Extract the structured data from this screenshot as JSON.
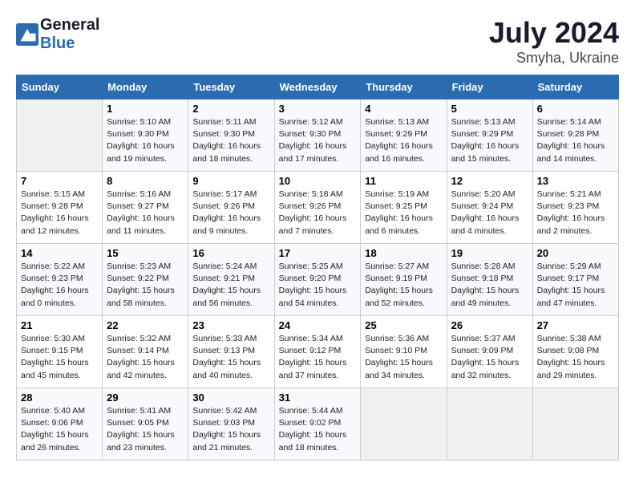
{
  "header": {
    "logo_text_general": "General",
    "logo_text_blue": "Blue",
    "month_year": "July 2024",
    "location": "Smyha, Ukraine"
  },
  "columns": [
    "Sunday",
    "Monday",
    "Tuesday",
    "Wednesday",
    "Thursday",
    "Friday",
    "Saturday"
  ],
  "rows": [
    [
      {
        "day": "",
        "empty": true
      },
      {
        "day": "1",
        "sunrise": "Sunrise: 5:10 AM",
        "sunset": "Sunset: 9:30 PM",
        "daylight": "Daylight: 16 hours and 19 minutes."
      },
      {
        "day": "2",
        "sunrise": "Sunrise: 5:11 AM",
        "sunset": "Sunset: 9:30 PM",
        "daylight": "Daylight: 16 hours and 18 minutes."
      },
      {
        "day": "3",
        "sunrise": "Sunrise: 5:12 AM",
        "sunset": "Sunset: 9:30 PM",
        "daylight": "Daylight: 16 hours and 17 minutes."
      },
      {
        "day": "4",
        "sunrise": "Sunrise: 5:13 AM",
        "sunset": "Sunset: 9:29 PM",
        "daylight": "Daylight: 16 hours and 16 minutes."
      },
      {
        "day": "5",
        "sunrise": "Sunrise: 5:13 AM",
        "sunset": "Sunset: 9:29 PM",
        "daylight": "Daylight: 16 hours and 15 minutes."
      },
      {
        "day": "6",
        "sunrise": "Sunrise: 5:14 AM",
        "sunset": "Sunset: 9:28 PM",
        "daylight": "Daylight: 16 hours and 14 minutes."
      }
    ],
    [
      {
        "day": "7",
        "sunrise": "Sunrise: 5:15 AM",
        "sunset": "Sunset: 9:28 PM",
        "daylight": "Daylight: 16 hours and 12 minutes."
      },
      {
        "day": "8",
        "sunrise": "Sunrise: 5:16 AM",
        "sunset": "Sunset: 9:27 PM",
        "daylight": "Daylight: 16 hours and 11 minutes."
      },
      {
        "day": "9",
        "sunrise": "Sunrise: 5:17 AM",
        "sunset": "Sunset: 9:26 PM",
        "daylight": "Daylight: 16 hours and 9 minutes."
      },
      {
        "day": "10",
        "sunrise": "Sunrise: 5:18 AM",
        "sunset": "Sunset: 9:26 PM",
        "daylight": "Daylight: 16 hours and 7 minutes."
      },
      {
        "day": "11",
        "sunrise": "Sunrise: 5:19 AM",
        "sunset": "Sunset: 9:25 PM",
        "daylight": "Daylight: 16 hours and 6 minutes."
      },
      {
        "day": "12",
        "sunrise": "Sunrise: 5:20 AM",
        "sunset": "Sunset: 9:24 PM",
        "daylight": "Daylight: 16 hours and 4 minutes."
      },
      {
        "day": "13",
        "sunrise": "Sunrise: 5:21 AM",
        "sunset": "Sunset: 9:23 PM",
        "daylight": "Daylight: 16 hours and 2 minutes."
      }
    ],
    [
      {
        "day": "14",
        "sunrise": "Sunrise: 5:22 AM",
        "sunset": "Sunset: 9:23 PM",
        "daylight": "Daylight: 16 hours and 0 minutes."
      },
      {
        "day": "15",
        "sunrise": "Sunrise: 5:23 AM",
        "sunset": "Sunset: 9:22 PM",
        "daylight": "Daylight: 15 hours and 58 minutes."
      },
      {
        "day": "16",
        "sunrise": "Sunrise: 5:24 AM",
        "sunset": "Sunset: 9:21 PM",
        "daylight": "Daylight: 15 hours and 56 minutes."
      },
      {
        "day": "17",
        "sunrise": "Sunrise: 5:25 AM",
        "sunset": "Sunset: 9:20 PM",
        "daylight": "Daylight: 15 hours and 54 minutes."
      },
      {
        "day": "18",
        "sunrise": "Sunrise: 5:27 AM",
        "sunset": "Sunset: 9:19 PM",
        "daylight": "Daylight: 15 hours and 52 minutes."
      },
      {
        "day": "19",
        "sunrise": "Sunrise: 5:28 AM",
        "sunset": "Sunset: 9:18 PM",
        "daylight": "Daylight: 15 hours and 49 minutes."
      },
      {
        "day": "20",
        "sunrise": "Sunrise: 5:29 AM",
        "sunset": "Sunset: 9:17 PM",
        "daylight": "Daylight: 15 hours and 47 minutes."
      }
    ],
    [
      {
        "day": "21",
        "sunrise": "Sunrise: 5:30 AM",
        "sunset": "Sunset: 9:15 PM",
        "daylight": "Daylight: 15 hours and 45 minutes."
      },
      {
        "day": "22",
        "sunrise": "Sunrise: 5:32 AM",
        "sunset": "Sunset: 9:14 PM",
        "daylight": "Daylight: 15 hours and 42 minutes."
      },
      {
        "day": "23",
        "sunrise": "Sunrise: 5:33 AM",
        "sunset": "Sunset: 9:13 PM",
        "daylight": "Daylight: 15 hours and 40 minutes."
      },
      {
        "day": "24",
        "sunrise": "Sunrise: 5:34 AM",
        "sunset": "Sunset: 9:12 PM",
        "daylight": "Daylight: 15 hours and 37 minutes."
      },
      {
        "day": "25",
        "sunrise": "Sunrise: 5:36 AM",
        "sunset": "Sunset: 9:10 PM",
        "daylight": "Daylight: 15 hours and 34 minutes."
      },
      {
        "day": "26",
        "sunrise": "Sunrise: 5:37 AM",
        "sunset": "Sunset: 9:09 PM",
        "daylight": "Daylight: 15 hours and 32 minutes."
      },
      {
        "day": "27",
        "sunrise": "Sunrise: 5:38 AM",
        "sunset": "Sunset: 9:08 PM",
        "daylight": "Daylight: 15 hours and 29 minutes."
      }
    ],
    [
      {
        "day": "28",
        "sunrise": "Sunrise: 5:40 AM",
        "sunset": "Sunset: 9:06 PM",
        "daylight": "Daylight: 15 hours and 26 minutes."
      },
      {
        "day": "29",
        "sunrise": "Sunrise: 5:41 AM",
        "sunset": "Sunset: 9:05 PM",
        "daylight": "Daylight: 15 hours and 23 minutes."
      },
      {
        "day": "30",
        "sunrise": "Sunrise: 5:42 AM",
        "sunset": "Sunset: 9:03 PM",
        "daylight": "Daylight: 15 hours and 21 minutes."
      },
      {
        "day": "31",
        "sunrise": "Sunrise: 5:44 AM",
        "sunset": "Sunset: 9:02 PM",
        "daylight": "Daylight: 15 hours and 18 minutes."
      },
      {
        "day": "",
        "empty": true
      },
      {
        "day": "",
        "empty": true
      },
      {
        "day": "",
        "empty": true
      }
    ]
  ]
}
